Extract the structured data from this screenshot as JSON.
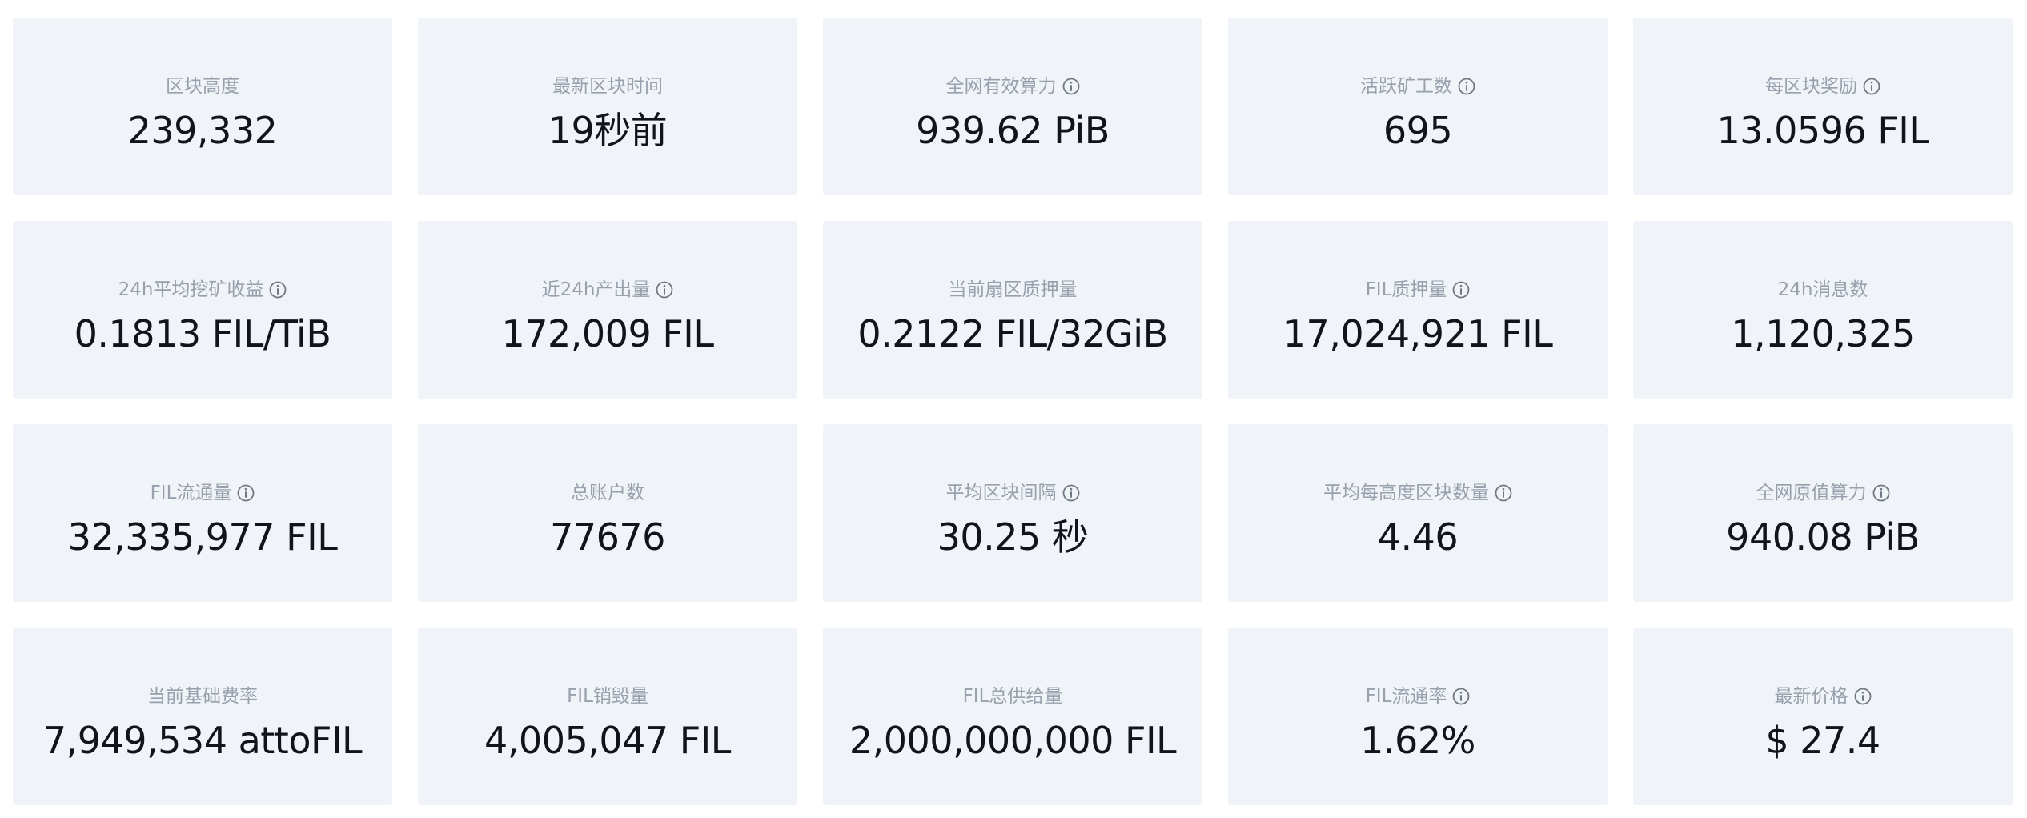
{
  "stats": [
    {
      "label": "区块高度",
      "value": "239,332",
      "info": false
    },
    {
      "label": "最新区块时间",
      "value": "19秒前",
      "info": false
    },
    {
      "label": "全网有效算力",
      "value": "939.62 PiB",
      "info": true
    },
    {
      "label": "活跃矿工数",
      "value": "695",
      "info": true
    },
    {
      "label": "每区块奖励",
      "value": "13.0596 FIL",
      "info": true
    },
    {
      "label": "24h平均挖矿收益",
      "value": "0.1813 FIL/TiB",
      "info": true
    },
    {
      "label": "近24h产出量",
      "value": "172,009 FIL",
      "info": true
    },
    {
      "label": "当前扇区质押量",
      "value": "0.2122 FIL/32GiB",
      "info": false
    },
    {
      "label": "FIL质押量",
      "value": "17,024,921 FIL",
      "info": true
    },
    {
      "label": "24h消息数",
      "value": "1,120,325",
      "info": false
    },
    {
      "label": "FIL流通量",
      "value": "32,335,977 FIL",
      "info": true
    },
    {
      "label": "总账户数",
      "value": "77676",
      "info": false
    },
    {
      "label": "平均区块间隔",
      "value": "30.25 秒",
      "info": true
    },
    {
      "label": "平均每高度区块数量",
      "value": "4.46",
      "info": true
    },
    {
      "label": "全网原值算力",
      "value": "940.08 PiB",
      "info": true
    },
    {
      "label": "当前基础费率",
      "value": "7,949,534 attoFIL",
      "info": false
    },
    {
      "label": "FIL销毁量",
      "value": "4,005,047 FIL",
      "info": false
    },
    {
      "label": "FIL总供给量",
      "value": "2,000,000,000 FIL",
      "info": false
    },
    {
      "label": "FIL流通率",
      "value": "1.62%",
      "info": true
    },
    {
      "label": "最新价格",
      "value": "$ 27.4",
      "info": true
    }
  ]
}
